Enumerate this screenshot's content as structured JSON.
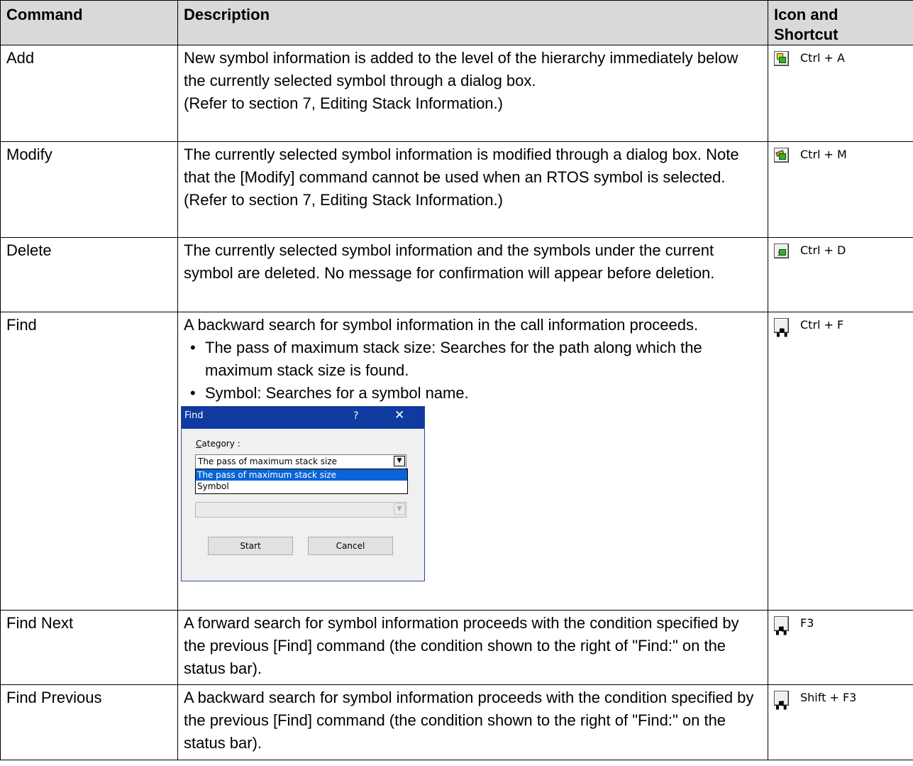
{
  "headers": {
    "command": "Command",
    "description": "Description",
    "icon_shortcut_line1": "Icon and",
    "icon_shortcut_line2": "Shortcut"
  },
  "rows": [
    {
      "command": "Add",
      "desc1": "New symbol information is added to the level of the hierarchy immediately below the currently selected symbol through a dialog box.",
      "desc2": "(Refer to section 7, Editing Stack Information.)",
      "icon": "add-symbol-icon",
      "shortcut": "Ctrl + A"
    },
    {
      "command": "Modify",
      "desc1": "The currently selected symbol information is modified through a dialog box. Note that the [Modify] command cannot be used when an RTOS symbol is selected.",
      "desc2": "(Refer to section 7, Editing Stack Information.)",
      "icon": "modify-symbol-icon",
      "shortcut": "Ctrl + M"
    },
    {
      "command": "Delete",
      "desc1": "The currently selected symbol information and the symbols under the current symbol are deleted. No message for confirmation will appear before deletion.",
      "icon": "delete-symbol-icon",
      "shortcut": "Ctrl + D"
    },
    {
      "command": "Find",
      "desc1": "A backward search for symbol information in the call information proceeds.",
      "bullet1": "The pass of maximum stack size: Searches for the path along which the maximum stack size is found.",
      "bullet2": "Symbol: Searches for a symbol name.",
      "icon": "binoculars-icon",
      "shortcut": "Ctrl + F"
    },
    {
      "command": "Find Next",
      "desc1": "A forward search for symbol information proceeds with the condition specified by the previous [Find] command (the condition shown to the right of \"Find:\" on the status bar).",
      "icon": "find-next-icon",
      "shortcut": "F3"
    },
    {
      "command": "Find Previous",
      "desc1": "A backward search for symbol information proceeds with the condition specified by the previous [Find] command (the condition shown to the right of \"Find:\" on the status bar).",
      "icon": "find-previous-icon",
      "shortcut": "Shift + F3"
    }
  ],
  "find_dialog": {
    "title": "Find",
    "help": "?",
    "close": "✕",
    "category_label_underlined": "C",
    "category_label_rest": "ategory :",
    "selected_value": "The pass of maximum stack size",
    "options": [
      "The pass of maximum stack size",
      "Symbol"
    ],
    "start_label": "Start",
    "cancel_label": "Cancel",
    "dropdown_arrow": "▼"
  }
}
